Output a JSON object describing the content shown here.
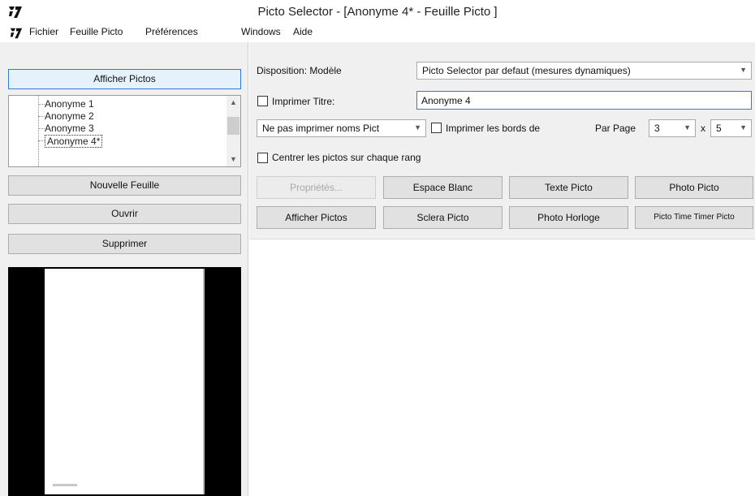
{
  "window": {
    "title": "Picto Selector - [Anonyme 4* - Feuille Picto ]"
  },
  "menu": [
    "Fichier",
    "Feuille Picto",
    "Préférences",
    "Windows",
    "Aide"
  ],
  "left_panel": {
    "show_pictos_button": "Afficher Pictos",
    "sheets": [
      "Anonyme 1",
      "Anonyme 2",
      "Anonyme 3",
      "Anonyme 4*"
    ],
    "new_sheet_button": "Nouvelle Feuille",
    "open_button": "Ouvrir",
    "delete_button": "Supprimer"
  },
  "options": {
    "layout_label": "Disposition: Modèle",
    "layout_value": "Picto Selector par defaut (mesures dynamiques)",
    "print_title_label": "Imprimer Titre:",
    "print_title_checked": false,
    "title_value": "Anonyme 4",
    "names_select_value": "Ne pas imprimer noms Pict",
    "print_borders_label": "Imprimer les bords de",
    "print_borders_checked": false,
    "per_page_label": "Par Page",
    "per_page_cols": "3",
    "per_page_x": "x",
    "per_page_rows": "5",
    "center_label": "Centrer les pictos sur chaque rang",
    "center_checked": false
  },
  "buttons": {
    "properties": "Propriétés...",
    "white_space": "Espace Blanc",
    "text_picto": "Texte Picto",
    "photo_picto": "Photo Picto",
    "show_pictos": "Afficher Pictos",
    "sclera_picto": "Sclera Picto",
    "photo_clock": "Photo Horloge",
    "time_timer": "Picto Time Timer Picto"
  },
  "colors": {
    "accent_border": "#2f7bd3",
    "panel_bg": "#f0f0f0",
    "preview_bg": "#000000"
  }
}
